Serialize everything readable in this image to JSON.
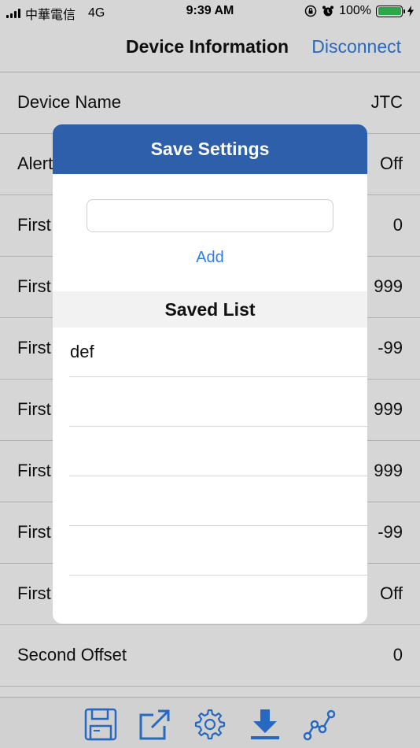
{
  "status_bar": {
    "carrier": "中華電信",
    "network": "4G",
    "time": "9:39 AM",
    "battery": "100%",
    "battery_level": 1.0,
    "battery_color": "#35c759"
  },
  "nav": {
    "title": "Device Information",
    "disconnect": "Disconnect"
  },
  "settings": {
    "rows": [
      {
        "label": "Device Name",
        "value": "JTC"
      },
      {
        "label": "Alert",
        "value": "Off"
      },
      {
        "label": "First",
        "value": "0"
      },
      {
        "label": "First",
        "value": "999"
      },
      {
        "label": "First",
        "value": "-99"
      },
      {
        "label": "First",
        "value": "999"
      },
      {
        "label": "First",
        "value": "999"
      },
      {
        "label": "First",
        "value": "-99"
      },
      {
        "label": "First",
        "value": "Off"
      },
      {
        "label": "Second Offset",
        "value": "0"
      }
    ]
  },
  "modal": {
    "title": "Save Settings",
    "input_value": "",
    "add_label": "Add",
    "saved_list_title": "Saved List",
    "saved_items": [
      "def",
      "",
      "",
      "",
      ""
    ]
  },
  "tab_bar": {
    "icons": [
      "save-icon",
      "share-icon",
      "gear-icon",
      "download-icon",
      "chart-icon"
    ],
    "accent": "#2f7ee5"
  },
  "colors": {
    "header_blue": "#2d5fab",
    "link_blue": "#2f7ee5"
  }
}
